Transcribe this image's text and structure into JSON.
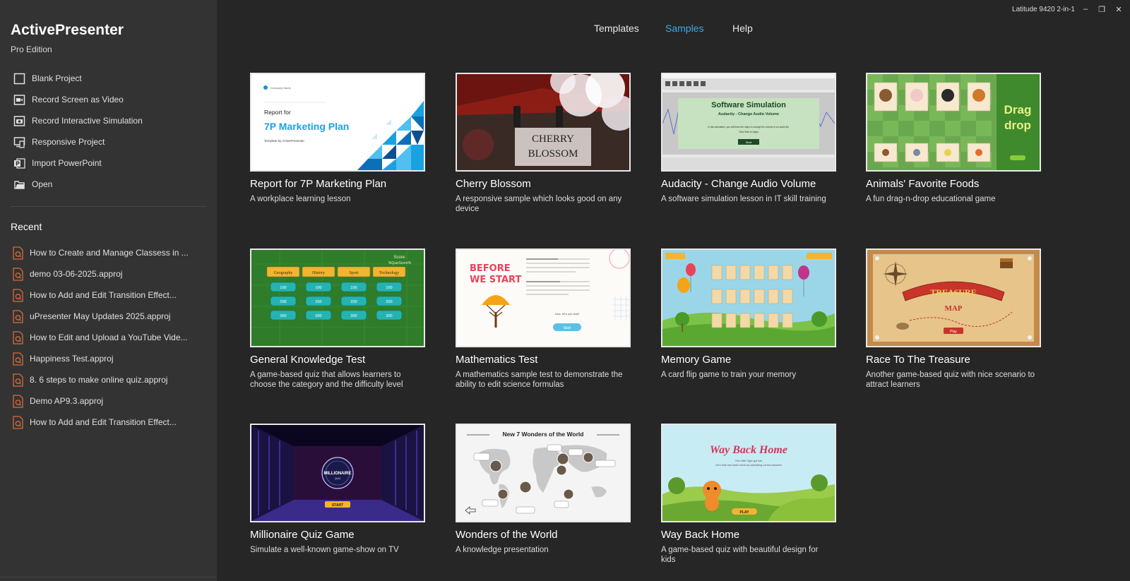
{
  "app": {
    "name": "ActivePresenter",
    "edition": "Pro Edition"
  },
  "window": {
    "device": "Latitude 9420 2-in-1"
  },
  "actions": [
    {
      "label": "Blank Project",
      "icon": "blank-project-icon"
    },
    {
      "label": "Record Screen as Video",
      "icon": "video-camera-icon"
    },
    {
      "label": "Record Interactive Simulation",
      "icon": "camera-icon"
    },
    {
      "label": "Responsive Project",
      "icon": "responsive-devices-icon"
    },
    {
      "label": "Import PowerPoint",
      "icon": "powerpoint-icon"
    },
    {
      "label": "Open",
      "icon": "open-folder-icon"
    }
  ],
  "recent": {
    "title": "Recent",
    "items": [
      "How to Create and Manage Classess in ...",
      "demo 03-06-2025.approj",
      "How to Add and Edit Transition Effect...",
      "uPresenter May Updates 2025.approj",
      "How to Edit and Upload a YouTube Vide...",
      "Happiness Test.approj",
      "8. 6 steps to make online quiz.approj",
      "Demo AP9.3.approj",
      "How to Add and Edit Transition Effect..."
    ]
  },
  "tabs": [
    {
      "label": "Templates",
      "active": false
    },
    {
      "label": "Samples",
      "active": true
    },
    {
      "label": "Help",
      "active": false
    }
  ],
  "colors": {
    "accent": "#3fa6e8",
    "sidebar": "#333333",
    "background": "#262626"
  },
  "samples": [
    {
      "title": "Report for 7P Marketing Plan",
      "desc": "A workplace learning lesson",
      "thumb": {
        "brand": "Company Name",
        "line1": "Report for",
        "line2": "7P Marketing Plan",
        "line3": "Template by ActivePresenter"
      }
    },
    {
      "title": "Cherry Blossom",
      "desc": "A responsive sample which looks good on any device",
      "thumb": {
        "line1": "CHERRY",
        "line2": "BLOSSOM"
      }
    },
    {
      "title": "Audacity - Change Audio Volume",
      "desc": "A software simulation lesson in IT skill training",
      "thumb": {
        "heading": "Software Simulation",
        "sub": "Audacity - Change Audio Volume",
        "body1": "In this simulation, you will learn the steps to change the volume of an audio file.",
        "body2": "Click Start to begin",
        "btn": "Start"
      }
    },
    {
      "title": "Animals' Favorite Foods",
      "desc": "A fun drag-n-drop educational game",
      "thumb": {
        "word1": "Drag",
        "word2": "drop"
      }
    },
    {
      "title": "General Knowledge Test",
      "desc": "A game-based quiz that allows learners to choose the category and the difficulty level",
      "thumb": {
        "score": "Score:",
        "scorevar": "%QuizScore%",
        "cats": [
          "Geography",
          "History",
          "Sport",
          "Technology"
        ],
        "rows": [
          "100",
          "200",
          "300"
        ]
      }
    },
    {
      "title": "Mathematics Test",
      "desc": "A mathematics sample test to demonstrate the ability to edit science formulas",
      "thumb": {
        "line1": "BEFORE",
        "line2": "WE START",
        "btn": "Start",
        "lets": "Now, let's you start!"
      }
    },
    {
      "title": "Memory Game",
      "desc": "A card flip game to train your memory",
      "thumb": {}
    },
    {
      "title": "Race To The Treasure",
      "desc": "Another game-based quiz with nice scenario to attract learners",
      "thumb": {
        "line1": "TREASURE",
        "line2": "MAP",
        "btn": "Play"
      }
    },
    {
      "title": "Millionaire Quiz Game",
      "desc": "Simulate a well-known game-show on TV",
      "thumb": {
        "logo": "MILLIONAIRE",
        "logosub": "QUIZ",
        "btn": "START"
      }
    },
    {
      "title": "Wonders of the World",
      "desc": "A knowledge presentation",
      "thumb": {
        "heading": "New 7 Wonders of the World"
      }
    },
    {
      "title": "Way Back Home",
      "desc": "A game-based quiz with beautiful design for kids",
      "thumb": {
        "heading": "Way Back Home",
        "sub1": "The Little Tiger got lost",
        "sub2": "Let's help him back home by submitting correct answers",
        "btn": "PLAY"
      }
    }
  ]
}
